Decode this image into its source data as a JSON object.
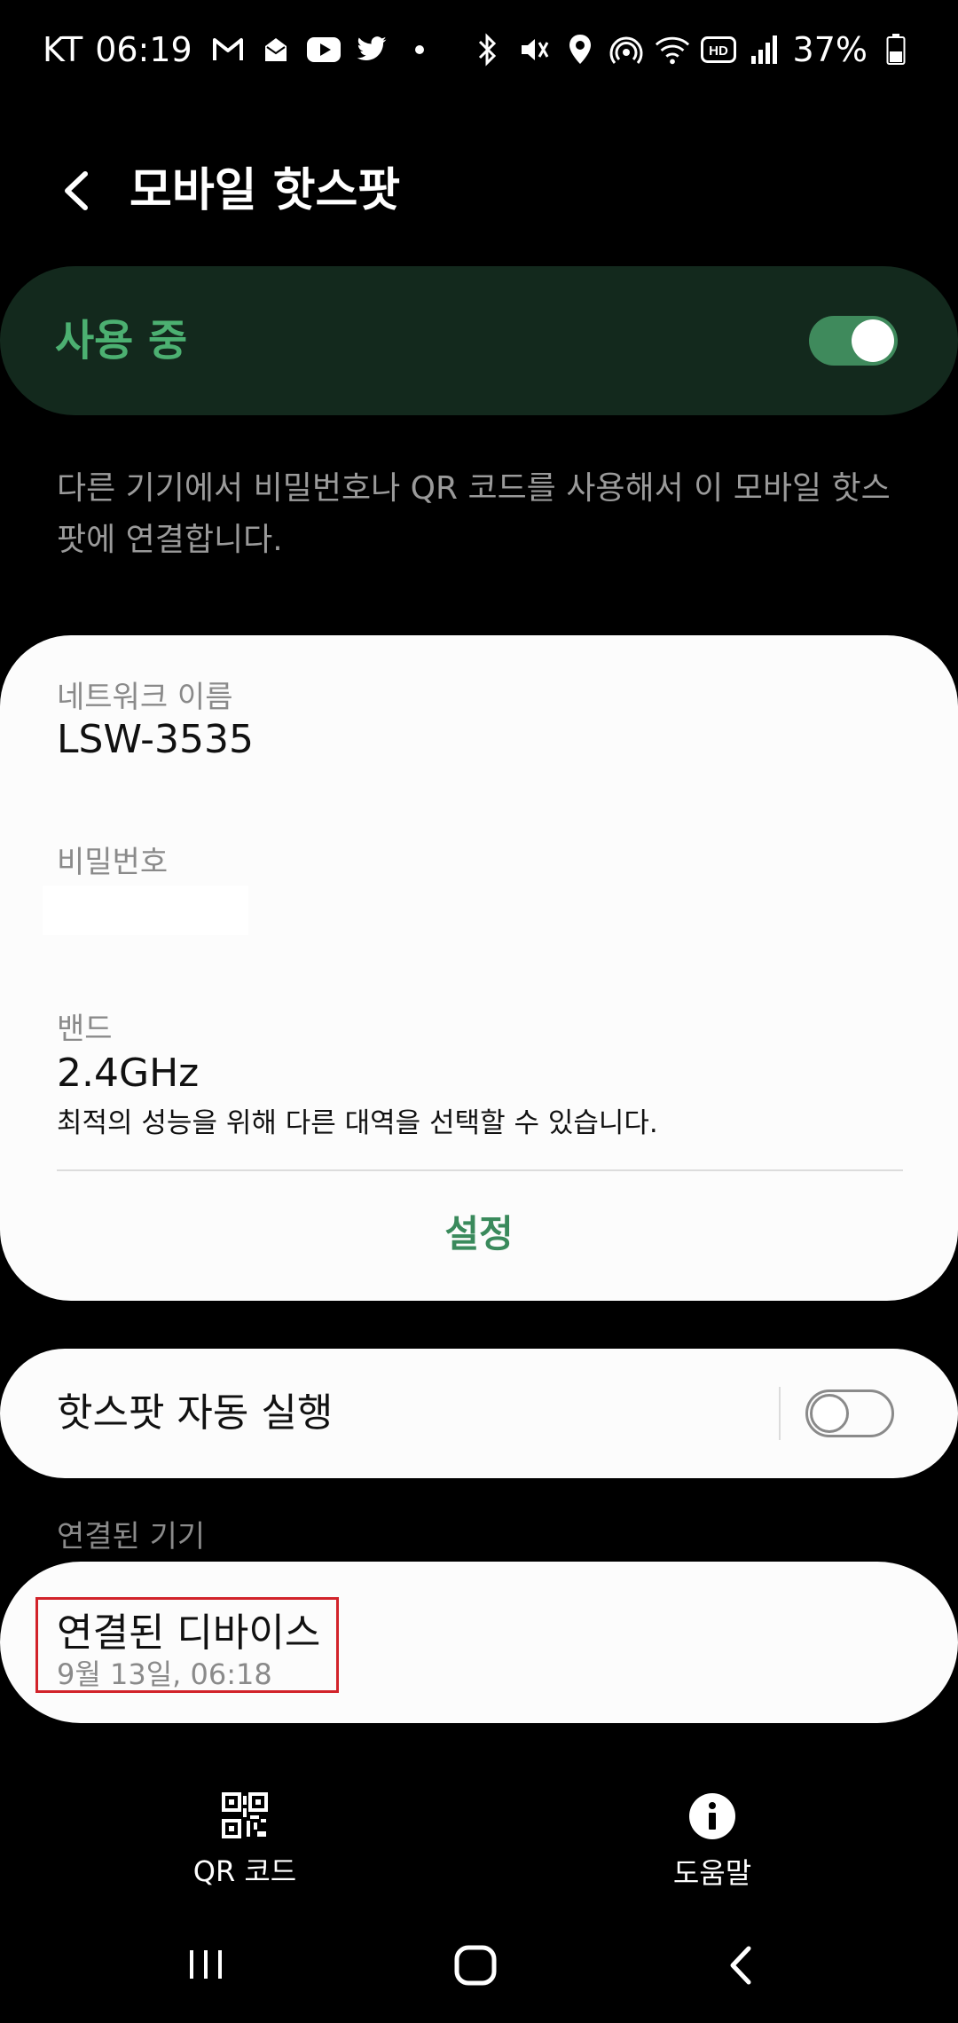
{
  "status_bar": {
    "carrier": "KT",
    "time": "06:19",
    "battery": "37%",
    "left_icons": [
      "gmail-icon",
      "mail-icon",
      "youtube-icon",
      "twitter-icon",
      "dot-icon"
    ],
    "right_icons": [
      "bluetooth-icon",
      "mute-icon",
      "location-icon",
      "hotspot-icon",
      "wifi-icon",
      "hd-icon",
      "signal-icon",
      "battery-icon"
    ]
  },
  "header": {
    "title": "모바일 핫스팟"
  },
  "master_switch": {
    "label": "사용 중",
    "on": true
  },
  "description": "다른 기기에서 비밀번호나 QR 코드를 사용해서 이 모바일 핫스팟에 연결합니다.",
  "info_card": {
    "network_name_label": "네트워크 이름",
    "network_name": "LSW-3535",
    "password_label": "비밀번호",
    "band_label": "밴드",
    "band_value": "2.4GHz",
    "band_note": "최적의 성능을 위해 다른 대역을 선택할 수 있습니다.",
    "settings_label": "설정"
  },
  "auto_hotspot": {
    "label": "핫스팟 자동 실행",
    "on": false
  },
  "connected": {
    "header": "연결된 기기",
    "device_name": "연결된 디바이스",
    "device_time": "9월 13일, 06:18"
  },
  "bottom_bar": {
    "qr_label": "QR 코드",
    "help_label": "도움말"
  },
  "colors": {
    "accent": "#4cb071",
    "master_card_bg": "#13291d",
    "toggle_on": "#3f8a5c",
    "settings_text": "#3a8a5c",
    "highlight_box": "#d2232a"
  }
}
